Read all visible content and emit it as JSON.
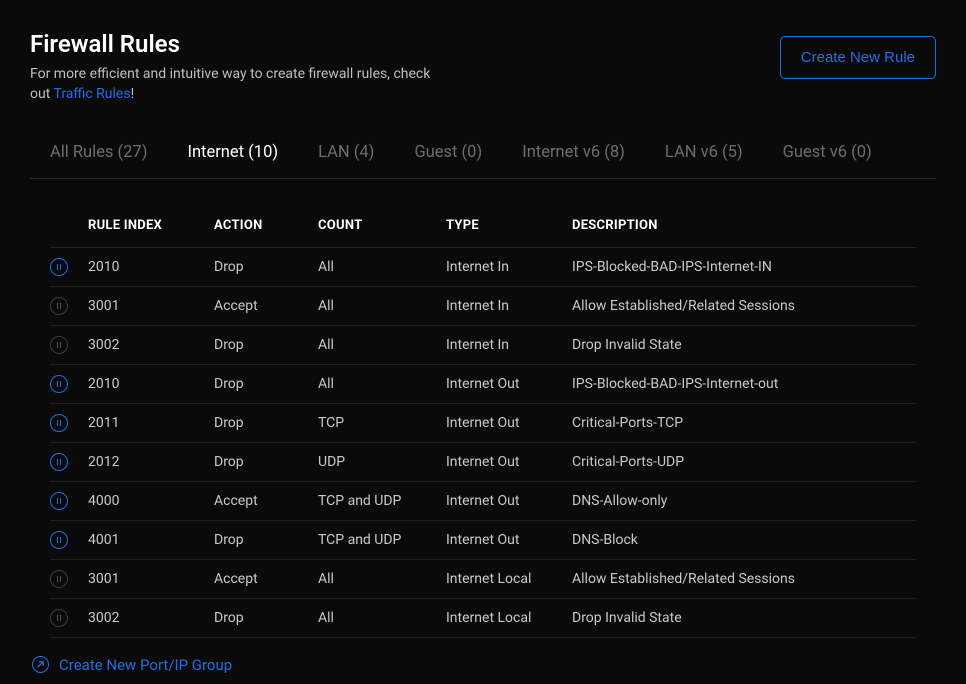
{
  "header": {
    "title": "Firewall Rules",
    "subtitle_pre": "For more efficient and intuitive way to create firewall rules, check out ",
    "subtitle_link": "Traffic Rules",
    "subtitle_post": "!",
    "create_button": "Create New Rule"
  },
  "tabs": [
    {
      "label": "All Rules (27)",
      "active": false
    },
    {
      "label": "Internet (10)",
      "active": true
    },
    {
      "label": "LAN (4)",
      "active": false
    },
    {
      "label": "Guest (0)",
      "active": false
    },
    {
      "label": "Internet v6 (8)",
      "active": false
    },
    {
      "label": "LAN v6 (5)",
      "active": false
    },
    {
      "label": "Guest v6 (0)",
      "active": false
    }
  ],
  "columns": {
    "rule_index": "RULE INDEX",
    "action": "ACTION",
    "count": "COUNT",
    "type": "TYPE",
    "description": "DESCRIPTION"
  },
  "rows": [
    {
      "dim": false,
      "rule_index": "2010",
      "action": "Drop",
      "count": "All",
      "type": "Internet In",
      "description": "IPS-Blocked-BAD-IPS-Internet-IN"
    },
    {
      "dim": true,
      "rule_index": "3001",
      "action": "Accept",
      "count": "All",
      "type": "Internet In",
      "description": "Allow Established/Related Sessions"
    },
    {
      "dim": true,
      "rule_index": "3002",
      "action": "Drop",
      "count": "All",
      "type": "Internet In",
      "description": "Drop Invalid State"
    },
    {
      "dim": false,
      "rule_index": "2010",
      "action": "Drop",
      "count": "All",
      "type": "Internet Out",
      "description": "IPS-Blocked-BAD-IPS-Internet-out"
    },
    {
      "dim": false,
      "rule_index": "2011",
      "action": "Drop",
      "count": "TCP",
      "type": "Internet Out",
      "description": "Critical-Ports-TCP"
    },
    {
      "dim": false,
      "rule_index": "2012",
      "action": "Drop",
      "count": "UDP",
      "type": "Internet Out",
      "description": "Critical-Ports-UDP"
    },
    {
      "dim": false,
      "rule_index": "4000",
      "action": "Accept",
      "count": "TCP and UDP",
      "type": "Internet Out",
      "description": "DNS-Allow-only"
    },
    {
      "dim": false,
      "rule_index": "4001",
      "action": "Drop",
      "count": "TCP and UDP",
      "type": "Internet Out",
      "description": "DNS-Block"
    },
    {
      "dim": true,
      "rule_index": "3001",
      "action": "Accept",
      "count": "All",
      "type": "Internet Local",
      "description": "Allow Established/Related Sessions"
    },
    {
      "dim": true,
      "rule_index": "3002",
      "action": "Drop",
      "count": "All",
      "type": "Internet Local",
      "description": "Drop Invalid State"
    }
  ],
  "footer": {
    "link": "Create New Port/IP Group"
  }
}
